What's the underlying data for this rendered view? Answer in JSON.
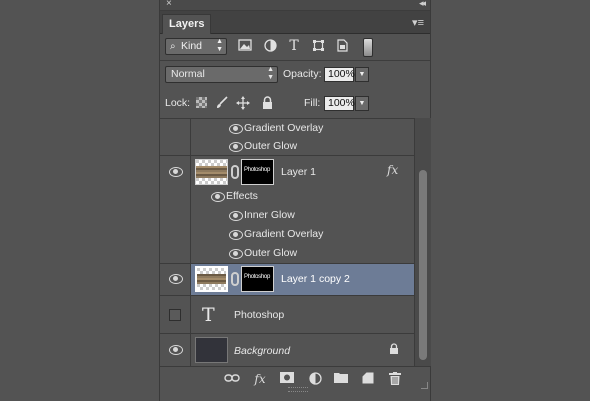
{
  "panel": {
    "close_glyph": "×",
    "collapse_glyph": "◂◂",
    "tab_label": "Layers",
    "menu_glyph": "▾≡"
  },
  "filter": {
    "search_glyph": "⌕",
    "kind_label": "Kind",
    "arrows": "▲▼",
    "icons": [
      "image-filter-icon",
      "adjustment-filter-icon",
      "type-filter-icon",
      "shape-filter-icon",
      "smart-object-filter-icon",
      "filter-toggle"
    ],
    "type_glyph": "T"
  },
  "blend": {
    "mode": "Normal",
    "arrows": "▲▼",
    "opacity_label": "Opacity:",
    "opacity_value": "100%",
    "fill_label": "Fill:",
    "fill_value": "100%",
    "drop_glyph": "▼"
  },
  "lock": {
    "label": "Lock:"
  },
  "layers": {
    "top_effects": [
      "Gradient Overlay",
      "Outer Glow"
    ],
    "layer1": {
      "name": "Layer 1",
      "mask_text": "Photoshop",
      "fx": "fx",
      "effects_label": "Effects",
      "effects": [
        "Inner Glow",
        "Gradient Overlay",
        "Outer Glow"
      ]
    },
    "layer1copy2": {
      "name": "Layer 1 copy 2",
      "mask_text": "Photoshop",
      "selected_color": "#6d7c96"
    },
    "type_layer": {
      "glyph": "T",
      "name": "Photoshop"
    },
    "background": {
      "name": "Background",
      "lock_glyph": "🔒"
    }
  },
  "bottom": {
    "link_glyph": "⊖",
    "fx_glyph": "fx",
    "mask_glyph": "◙",
    "adjust_glyph": "◐",
    "folder_glyph": "▬",
    "new_glyph": "❐",
    "trash_glyph": "🗑"
  }
}
